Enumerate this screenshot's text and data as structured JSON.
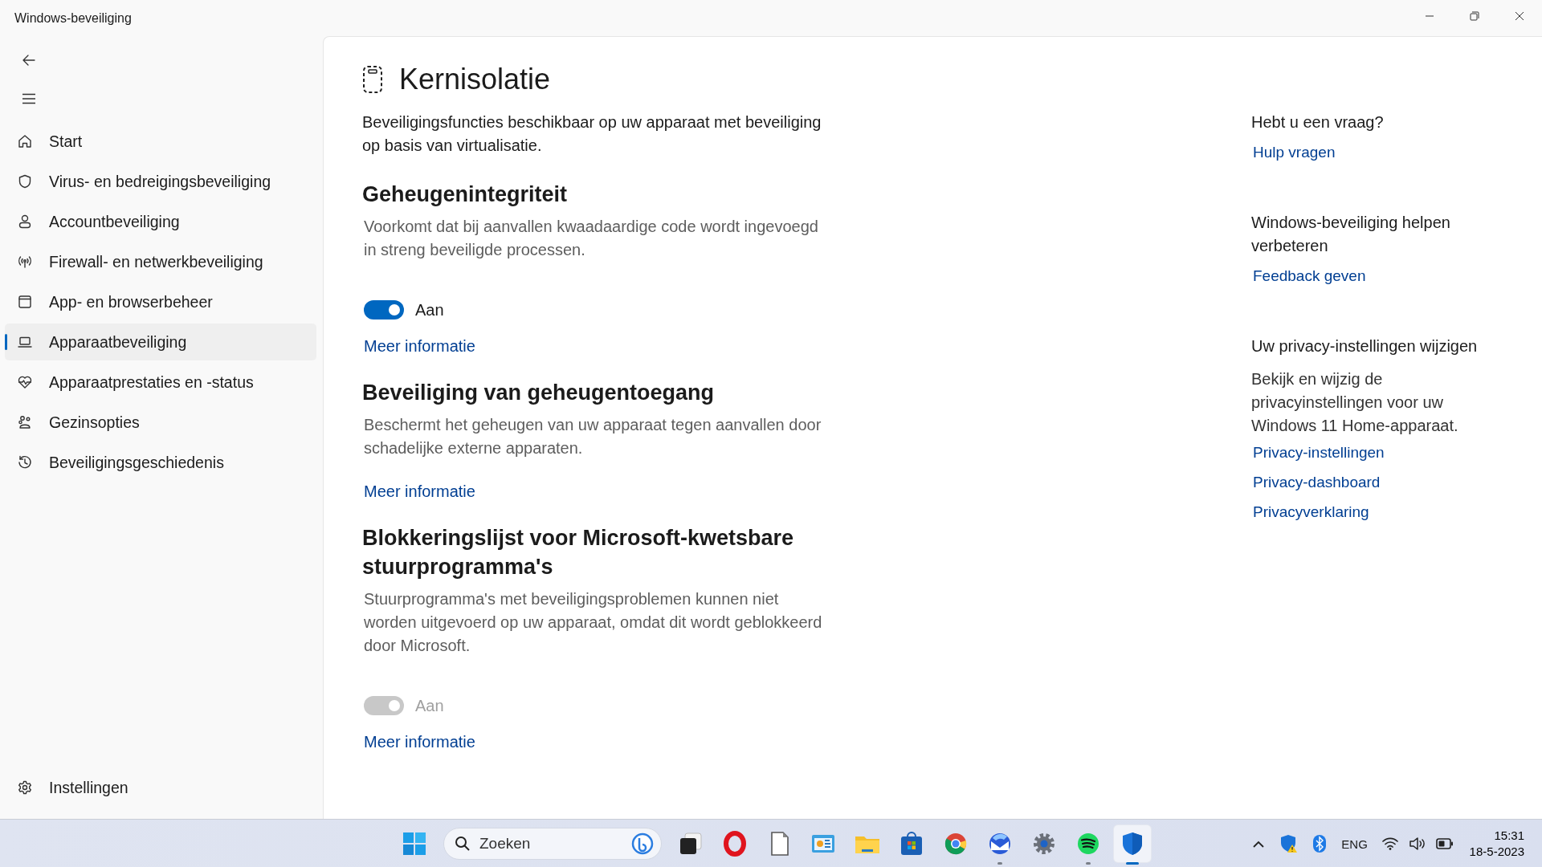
{
  "window": {
    "title": "Windows-beveiliging"
  },
  "sidebar": {
    "items": [
      {
        "label": "Start",
        "kind": "home",
        "selected": false
      },
      {
        "label": "Virus- en bedreigingsbeveiliging",
        "kind": "shield",
        "selected": false
      },
      {
        "label": "Accountbeveiliging",
        "kind": "person",
        "selected": false
      },
      {
        "label": "Firewall- en netwerkbeveiliging",
        "kind": "antenna",
        "selected": false
      },
      {
        "label": "App- en browserbeheer",
        "kind": "window",
        "selected": false
      },
      {
        "label": "Apparaatbeveiliging",
        "kind": "laptop",
        "selected": true
      },
      {
        "label": "Apparaatprestaties en -status",
        "kind": "heart",
        "selected": false
      },
      {
        "label": "Gezinsopties",
        "kind": "family",
        "selected": false
      },
      {
        "label": "Beveiligingsgeschiedenis",
        "kind": "history",
        "selected": false
      }
    ],
    "footer": {
      "label": "Instellingen",
      "kind": "gear"
    }
  },
  "page": {
    "title": "Kernisolatie",
    "description": "Beveiligingsfuncties beschikbaar op uw apparaat met beveiliging op basis van virtualisatie.",
    "sections": [
      {
        "heading": "Geheugenintegriteit",
        "description": "Voorkomt dat bij aanvallen kwaadaardige code wordt ingevoegd in streng beveiligde processen.",
        "toggle": {
          "on": true,
          "disabled": false,
          "label": "Aan"
        },
        "link": "Meer informatie"
      },
      {
        "heading": "Beveiliging van geheugentoegang",
        "description": "Beschermt het geheugen van uw apparaat tegen aanvallen door schadelijke externe apparaten.",
        "link": "Meer informatie"
      },
      {
        "heading": "Blokkeringslijst voor Microsoft-kwetsbare stuurprogramma's",
        "description": "Stuurprogramma's met beveiligingsproblemen kunnen niet worden uitgevoerd op uw apparaat, omdat dit wordt geblokkeerd door Microsoft.",
        "toggle": {
          "on": true,
          "disabled": true,
          "label": "Aan"
        },
        "link": "Meer informatie"
      }
    ]
  },
  "aside": {
    "groups": [
      {
        "heading": "Hebt u een vraag?",
        "links": [
          "Hulp vragen"
        ]
      },
      {
        "heading": "Windows-beveiliging helpen verbeteren",
        "links": [
          "Feedback geven"
        ]
      },
      {
        "heading": "Uw privacy-instellingen wijzigen",
        "text": "Bekijk en wijzig de privacyinstellingen voor uw Windows 11 Home-apparaat.",
        "links": [
          "Privacy-instellingen",
          "Privacy-dashboard",
          "Privacyverklaring"
        ]
      }
    ]
  },
  "taskbar": {
    "search": {
      "placeholder": "Zoeken"
    },
    "apps": [
      {
        "kind": "taskview",
        "running": false,
        "selected": false
      },
      {
        "kind": "opera",
        "running": false,
        "selected": false
      },
      {
        "kind": "document",
        "running": false,
        "selected": false
      },
      {
        "kind": "chartapp",
        "running": false,
        "selected": false
      },
      {
        "kind": "folder",
        "running": false,
        "selected": false
      },
      {
        "kind": "store",
        "running": false,
        "selected": false
      },
      {
        "kind": "chrome",
        "running": false,
        "selected": false
      },
      {
        "kind": "mail",
        "running": true,
        "selected": false
      },
      {
        "kind": "settings",
        "running": false,
        "selected": false
      },
      {
        "kind": "spotify",
        "running": true,
        "selected": false
      },
      {
        "kind": "defender",
        "running": true,
        "selected": true
      }
    ],
    "tray": {
      "language": "ENG",
      "time": "15:31",
      "date": "18-5-2023"
    }
  }
}
